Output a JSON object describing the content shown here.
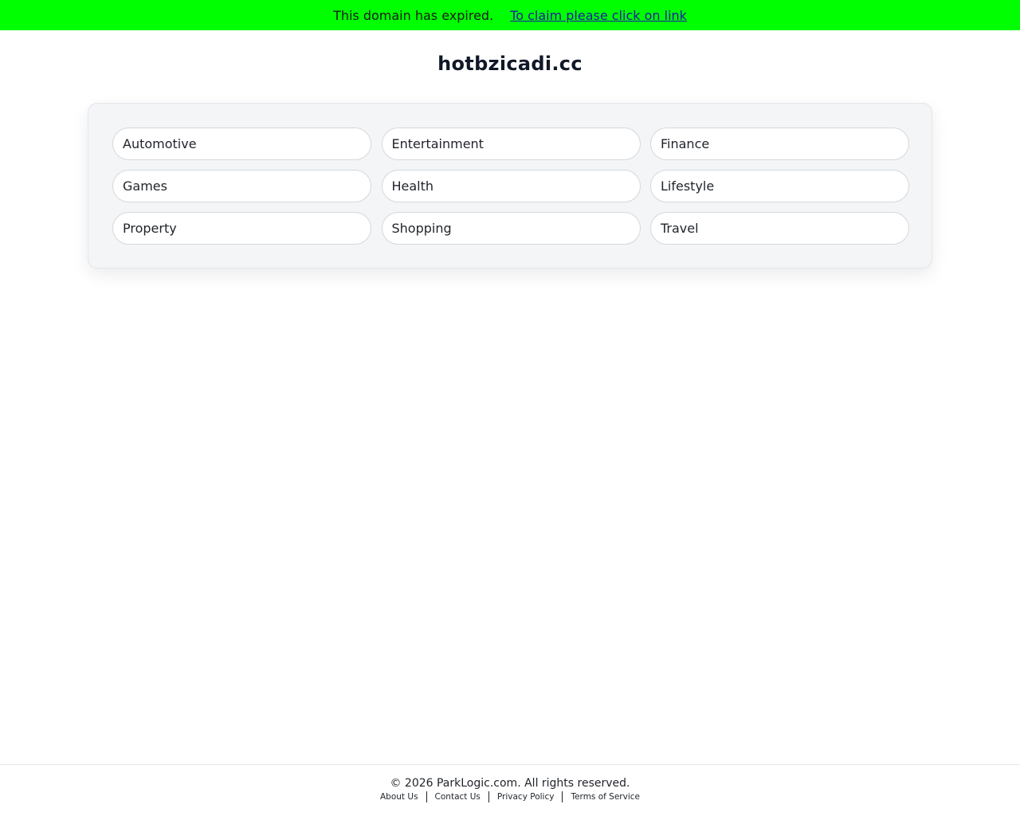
{
  "banner": {
    "message": "This domain has expired.",
    "link_text": "To claim please click on link",
    "background_color": "#00ff00"
  },
  "domain": "hotbzicadi.cc",
  "categories": [
    "Automotive",
    "Entertainment",
    "Finance",
    "Games",
    "Health",
    "Lifestyle",
    "Property",
    "Shopping",
    "Travel"
  ],
  "footer": {
    "copyright": "© 2026 ParkLogic.com. All rights reserved.",
    "links": [
      "About Us",
      "Contact Us",
      "Privacy Policy",
      "Terms of Service"
    ]
  }
}
